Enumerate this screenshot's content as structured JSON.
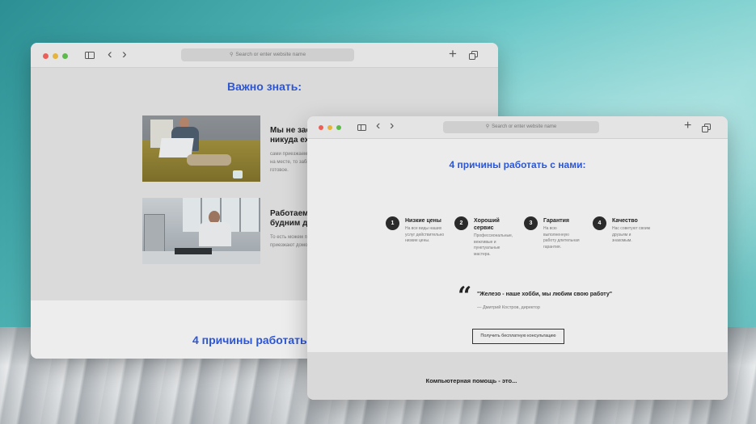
{
  "browser": {
    "url_placeholder": "Search or enter website name",
    "new_tab": "+",
    "back": "‹",
    "forward": "›"
  },
  "back_window": {
    "section_title": "Важно знать:",
    "cards": [
      {
        "heading_line1": "Мы не зас",
        "heading_line2": "никуда еха",
        "text_line1": "сами приезжаем,",
        "text_line2": "на месте, то забир",
        "text_line3": "готовое."
      },
      {
        "heading_line1": "Работаем",
        "heading_line2": "будним дн",
        "text_line1": "То есть можем пр",
        "text_line2": "приезжают домо"
      }
    ],
    "footer_title": "4 причины работать с н"
  },
  "front_window": {
    "section_title": "4 причины работать с нами:",
    "reasons": [
      {
        "number": "1",
        "title_line1": "Низкие цены",
        "title_line2": "",
        "text_lines": [
          "На все виды наших",
          "услуг действительно",
          "низкие цены."
        ]
      },
      {
        "number": "2",
        "title_line1": "Хороший",
        "title_line2": "сервис",
        "text_lines": [
          "Профессиональные,",
          "вежливые и",
          "пунктуальные",
          "мастера."
        ]
      },
      {
        "number": "3",
        "title_line1": "Гарантия",
        "title_line2": "",
        "text_lines": [
          "На всю",
          "выполненную",
          "работу длительная",
          "гарантия."
        ]
      },
      {
        "number": "4",
        "title_line1": "Качество",
        "title_line2": "",
        "text_lines": [
          "Нас советуют своим",
          "друзьям и",
          "знакомым."
        ]
      }
    ],
    "quote_mark": "“",
    "quote_text": "\"Железо - наше хобби, мы любим свою работу\"",
    "quote_author": "— Дмитрий Костров, директор",
    "cta_button": "Получить бесплатную консультацию",
    "footer_title": "Компьютерная помощь - это..."
  }
}
